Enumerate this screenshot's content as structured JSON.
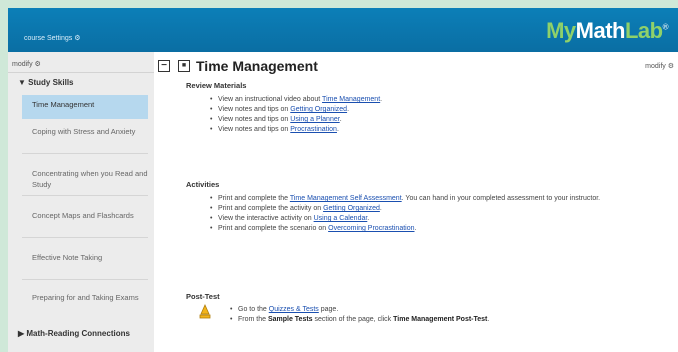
{
  "header": {
    "course_settings": "course Settings ⚙",
    "logo": {
      "my": "My",
      "math": "Math",
      "lab": "Lab",
      "reg": "®"
    }
  },
  "sidebar": {
    "modify": "modify ⚙",
    "study_skills": "▼ Study Skills",
    "items": [
      {
        "label": "Time Management"
      },
      {
        "label": "Coping with Stress and Anxiety"
      },
      {
        "label": "Concentrating when you Read and Study"
      },
      {
        "label": "Concept Maps and Flashcards"
      },
      {
        "label": "Effective Note Taking"
      },
      {
        "label": "Preparing for and Taking Exams"
      }
    ],
    "math_reading": "▶ Math-Reading Connections"
  },
  "main": {
    "collapse_icon": "−",
    "title_icon": "■",
    "title": "Time Management",
    "modify": "modify ⚙",
    "review": {
      "heading": "Review Materials",
      "items": [
        {
          "pre": "View an instructional video about ",
          "link": "Time Management",
          "post": "."
        },
        {
          "pre": "View notes and tips on ",
          "link": "Getting Organized",
          "post": "."
        },
        {
          "pre": "View notes and tips on ",
          "link": "Using a Planner",
          "post": "."
        },
        {
          "pre": "View notes and tips on ",
          "link": "Procrastination",
          "post": "."
        }
      ]
    },
    "activities": {
      "heading": "Activities",
      "items": [
        {
          "pre": "Print and complete the ",
          "link": "Time Management Self Assessment",
          "post": ". You can hand in your completed assessment to your instructor."
        },
        {
          "pre": "Print and complete the activity on ",
          "link": "Getting Organized",
          "post": "."
        },
        {
          "pre": "View the interactive activity on ",
          "link": "Using a Calendar",
          "post": "."
        },
        {
          "pre": "Print and complete the scenario on ",
          "link": "Overcoming Procrastination",
          "post": "."
        }
      ]
    },
    "post_test": {
      "heading": "Post-Test",
      "item1": {
        "pre": "Go to the ",
        "link": "Quizzes & Tests",
        "post": " page."
      },
      "item2": {
        "pre": "From the ",
        "bold1": "Sample Tests",
        "mid": " section of the page, click ",
        "bold2": "Time Management Post-Test",
        "post": "."
      }
    }
  }
}
